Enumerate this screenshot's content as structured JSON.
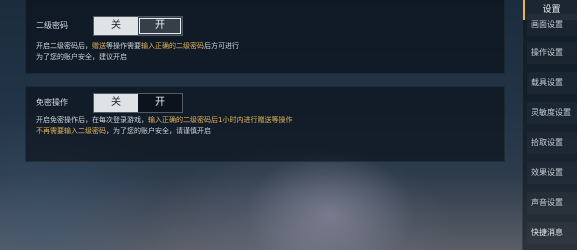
{
  "section1": {
    "label": "二级密码",
    "toggle_off": "关",
    "toggle_on": "开",
    "desc_line1_a": "开启二级密码后，",
    "desc_line1_hl1": "赠送",
    "desc_line1_b": "等操作需要",
    "desc_line1_hl2": "输入正确的二级密码",
    "desc_line1_c": "后方可进行",
    "desc_line2": "为了您的账户安全，建议开启"
  },
  "section2": {
    "label": "免密操作",
    "toggle_off": "关",
    "toggle_on": "开",
    "desc_line1_a": "开启免密操作后，在每次登录游戏，",
    "desc_line1_hl": "输入正确的二级密码后1小时内进行赠送等操作",
    "desc_line2_hl": "不再需要输入二级密码",
    "desc_line2_b": "，为了您的账户安全，请谨慎开启"
  },
  "sidebar": {
    "title": "设置",
    "items": [
      "画面设置",
      "操作设置",
      "载具设置",
      "灵敏度设置",
      "拾取设置",
      "效果设置",
      "声音设置",
      "快捷消息"
    ]
  },
  "colors": {
    "highlight": "#e3b45a",
    "panel_bg": "rgba(8,14,22,0.62)",
    "text": "#d8dde2"
  }
}
